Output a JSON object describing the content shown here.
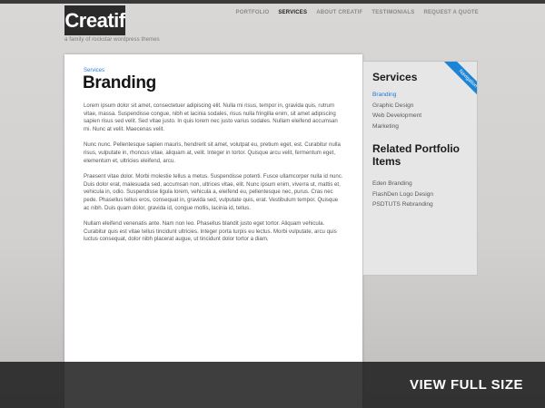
{
  "header": {
    "logo": "Creatif",
    "tagline": "a family of rockstar wordpress themes",
    "nav": [
      {
        "label": "PORTFOLIO",
        "active": false
      },
      {
        "label": "SERVICES",
        "active": true
      },
      {
        "label": "ABOUT CREATIF",
        "active": false
      },
      {
        "label": "TESTIMONIALS",
        "active": false
      },
      {
        "label": "REQUEST A QUOTE",
        "active": false
      }
    ]
  },
  "main": {
    "eyebrow": "Services",
    "title": "Branding",
    "paragraphs": [
      "Lorem ipsum dolor sit amet, consectetuer adipiscing elit. Nulla mi risus, tempor in, gravida quis, rutrum vitae, massa. Suspendisse congue, nibh et lacinia sodales, risus nulla fringilla enim, sit amet adipiscing sapien risus sed velit. Sed vitae justo. In quis lorem nec justo varius sodales. Nullam eleifend accumsan mi. Nunc at velit. Maecenas velit.",
      "Nunc nunc. Pellentesque sapien mauris, hendrerit sit amet, volutpat eu, pretium eget, est. Curabitur nulla risus, vulputate in, rhoncus vitae, aliquam at, velit. Integer in tortor. Quisque arcu velit, fermentum eget, elementum et, ultricies eleifend, arcu.",
      "Praesent vitae dolor. Morbi molestie tellus a metus. Suspendisse potenti. Fusce ullamcorper nulla id nunc. Duis dolor erat, malesuada sed, accumsan non, ultrices vitae, elit. Nunc ipsum enim, viverra ut, mattis et, vehicula in, odio. Suspendisse ligula lorem, vehicula a, eleifend eu, pellentesque nec, purus. Cras nec pede. Phasellus tellus eros, consequat in, gravida sed, vulputate quis, erat. Vestibulum tempor. Quisque ac nibh. Duis quam dolor, gravida id, congue mollis, lacinia id, tellus.",
      "Nullam eleifend venenatis ante. Nam non leo. Phasellus blandit justo eget tortor. Aliquam vehicula. Curabitur quis est vitae tellus tincidunt ultricies. Integer porta turpis eu lectus. Morbi vulputate, arcu quis luctus consequat, dolor nibh placerat augue, ut tincidunt dolor tortor a diam."
    ]
  },
  "sidebar": {
    "ribbon": "Navigation",
    "services_heading": "Services",
    "services": [
      {
        "label": "Branding",
        "active": true
      },
      {
        "label": "Graphic Design",
        "active": false
      },
      {
        "label": "Web Development",
        "active": false
      },
      {
        "label": "Marketing",
        "active": false
      }
    ],
    "related_heading": "Related Portfolio Items",
    "related": [
      "Eden Branding",
      "FlashDen Logo Design",
      "PSDTUTS Rebranding"
    ]
  },
  "overlay": {
    "label": "VIEW FULL SIZE"
  },
  "colors": {
    "accent": "#1e78d4",
    "ribbon": "#1b84d6",
    "logo_bg": "#2b2b2b"
  }
}
